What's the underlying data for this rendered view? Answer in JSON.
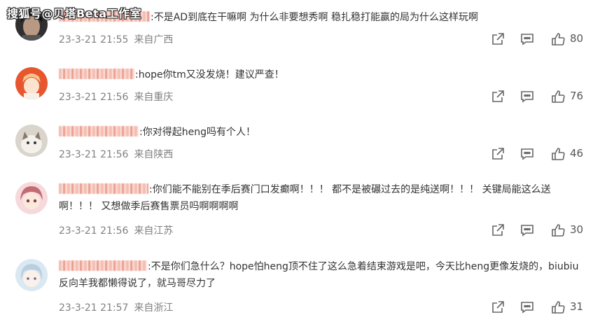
{
  "watermark": "搜狐号@贝塔Beta工作室",
  "comments": [
    {
      "content": ":不是AD到底在干嘛啊 为什么非要想秀啊 稳扎稳打能赢的局为什么这样玩啊",
      "time": "23-3-21 21:55",
      "location": "来自广西",
      "likes": "80",
      "avatar_color": "#3a3a3a"
    },
    {
      "content": ":hope你tm又没发烧！建议严查！",
      "time": "23-3-21 21:56",
      "location": "来自重庆",
      "likes": "76",
      "avatar_color": "#e8562f"
    },
    {
      "content": ":你对得起heng吗有个人！",
      "time": "23-3-21 21:56",
      "location": "来自陕西",
      "likes": "46",
      "avatar_color": "#c9c4bd"
    },
    {
      "content": ":你们能不能别在季后赛门口发癫啊！！！ 都不是被碾过去的是纯送啊！！！ 关键局能这么送啊！！！ 又想做季后赛售票员吗啊啊啊啊",
      "time": "23-3-21 21:56",
      "location": "来自江苏",
      "likes": "30",
      "avatar_color": "#f2b8c0"
    },
    {
      "content": ":不是你们急什么？hope怕heng顶不住了这么急着结束游戏是吧，今天比heng更像发烧的，biubiu反向羊我都懒得说了，就马哥尽力了",
      "time": "23-3-21 21:57",
      "location": "来自浙江",
      "likes": "31",
      "avatar_color": "#b8d4e8"
    }
  ]
}
